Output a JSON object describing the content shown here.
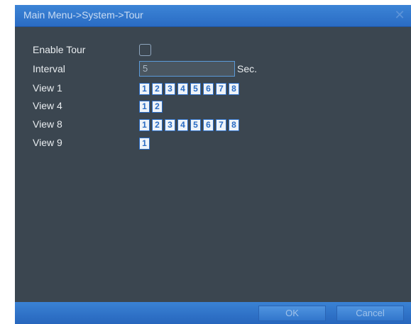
{
  "window": {
    "title": "Main Menu->System->Tour",
    "close_glyph": "✕"
  },
  "settings": {
    "enable_tour": {
      "label": "Enable Tour",
      "checked": false
    },
    "interval": {
      "label": "Interval",
      "value": "5",
      "unit": "Sec."
    }
  },
  "views": [
    {
      "label": "View 1",
      "channels": [
        "1",
        "2",
        "3",
        "4",
        "5",
        "6",
        "7",
        "8"
      ]
    },
    {
      "label": "View 4",
      "channels": [
        "1",
        "2"
      ]
    },
    {
      "label": "View 8",
      "channels": [
        "1",
        "2",
        "3",
        "4",
        "5",
        "6",
        "7",
        "8"
      ]
    },
    {
      "label": "View 9",
      "channels": [
        "1"
      ]
    }
  ],
  "buttons": {
    "ok": "OK",
    "cancel": "Cancel"
  },
  "colors": {
    "titlebar": "#2a6cc4",
    "panel_background": "#3b4650",
    "channel_box": "#eef3f8",
    "accent": "#5b9ad8"
  }
}
